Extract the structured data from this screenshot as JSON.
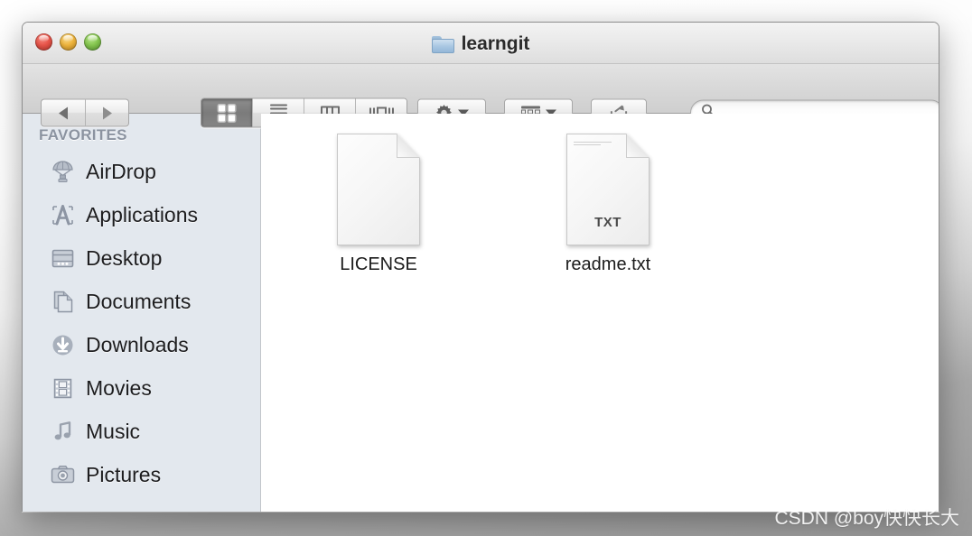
{
  "window": {
    "title": "learngit",
    "title_icon": "folder-icon",
    "traffic_lights": [
      {
        "name": "close-button",
        "color": "#e8554a"
      },
      {
        "name": "minimize-button",
        "color": "#eeb43c"
      },
      {
        "name": "zoom-button",
        "color": "#86c750"
      }
    ]
  },
  "toolbar": {
    "back_label": "Back",
    "forward_label": "Forward",
    "view_modes": [
      {
        "name": "icon-view",
        "label": "Icon View",
        "selected": true
      },
      {
        "name": "list-view",
        "label": "List View",
        "selected": false
      },
      {
        "name": "column-view",
        "label": "Column View",
        "selected": false
      },
      {
        "name": "coverflow-view",
        "label": "Cover Flow View",
        "selected": false
      }
    ],
    "action_label": "Action",
    "arrange_label": "Arrange By",
    "share_label": "Share"
  },
  "search": {
    "value": "",
    "placeholder": ""
  },
  "sidebar": {
    "header": "FAVORITES",
    "items": [
      {
        "label": "AirDrop",
        "icon": "airdrop-icon"
      },
      {
        "label": "Applications",
        "icon": "applications-icon"
      },
      {
        "label": "Desktop",
        "icon": "desktop-icon"
      },
      {
        "label": "Documents",
        "icon": "documents-icon"
      },
      {
        "label": "Downloads",
        "icon": "downloads-icon"
      },
      {
        "label": "Movies",
        "icon": "movies-icon"
      },
      {
        "label": "Music",
        "icon": "music-icon"
      },
      {
        "label": "Pictures",
        "icon": "pictures-icon"
      }
    ]
  },
  "content": {
    "files": [
      {
        "label": "LICENSE",
        "kind": "blank-document",
        "badge": ""
      },
      {
        "label": "readme.txt",
        "kind": "text-document",
        "badge": "TXT"
      }
    ]
  },
  "watermark": {
    "text": "CSDN @boy快快长大"
  }
}
